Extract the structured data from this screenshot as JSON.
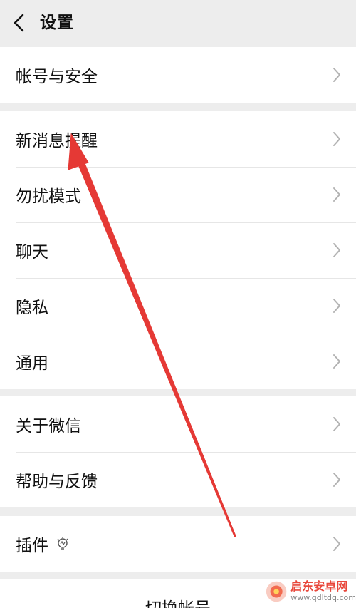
{
  "header": {
    "title": "设置",
    "back_icon": "chevron-left-icon"
  },
  "groups": [
    {
      "items": [
        {
          "label": "帐号与安全"
        }
      ]
    },
    {
      "items": [
        {
          "label": "新消息提醒"
        },
        {
          "label": "勿扰模式"
        },
        {
          "label": "聊天"
        },
        {
          "label": "隐私"
        },
        {
          "label": "通用"
        }
      ]
    },
    {
      "items": [
        {
          "label": "关于微信"
        },
        {
          "label": "帮助与反馈"
        }
      ]
    },
    {
      "items": [
        {
          "label": "插件",
          "icon": "lightbulb-icon"
        }
      ]
    }
  ],
  "switch_account": {
    "label": "切换帐号"
  },
  "annotation": {
    "color": "#e53935"
  },
  "watermark": {
    "name": "启东安卓网",
    "url": "www.qdltdq.com"
  }
}
